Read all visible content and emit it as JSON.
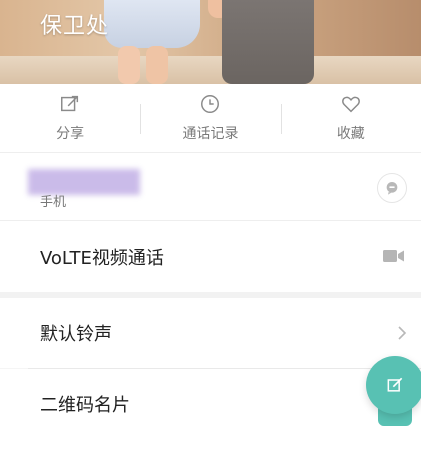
{
  "contact": {
    "name": "保卫处"
  },
  "actions": [
    {
      "label": "分享",
      "icon": "share-icon"
    },
    {
      "label": "通话记录",
      "icon": "clock-icon"
    },
    {
      "label": "收藏",
      "icon": "heart-icon"
    }
  ],
  "phone": {
    "label": "手机",
    "number_state": "blurred",
    "message_icon": "message-icon"
  },
  "volte": {
    "label": "VoLTE视频通话",
    "icon": "video-camera-icon"
  },
  "ringtone": {
    "label": "默认铃声",
    "icon": "chevron-right-icon"
  },
  "qr": {
    "label": "二维码名片"
  },
  "fab": {
    "icon": "edit-icon",
    "color": "#58c1b3"
  }
}
